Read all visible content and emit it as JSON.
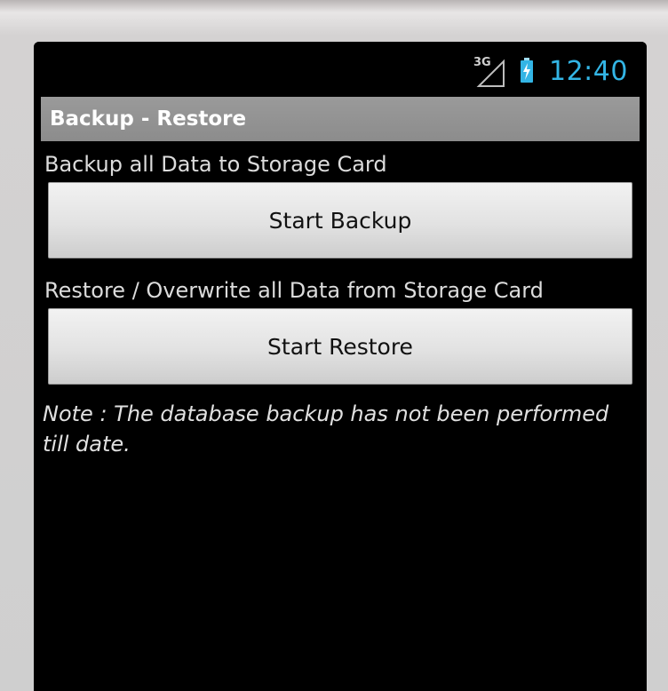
{
  "status_bar": {
    "network_type": "3G",
    "time": "12:40",
    "network_icon": "signal-icon",
    "battery_icon": "battery-charging-icon",
    "clock_color": "#33b5e5"
  },
  "app": {
    "title": "Backup - Restore"
  },
  "backup": {
    "description": "Backup all Data to Storage Card",
    "button_label": "Start Backup"
  },
  "restore": {
    "description": "Restore / Overwrite all Data from Storage Card",
    "button_label": "Start Restore"
  },
  "note": {
    "text": "Note : The database backup has not been performed till date."
  }
}
